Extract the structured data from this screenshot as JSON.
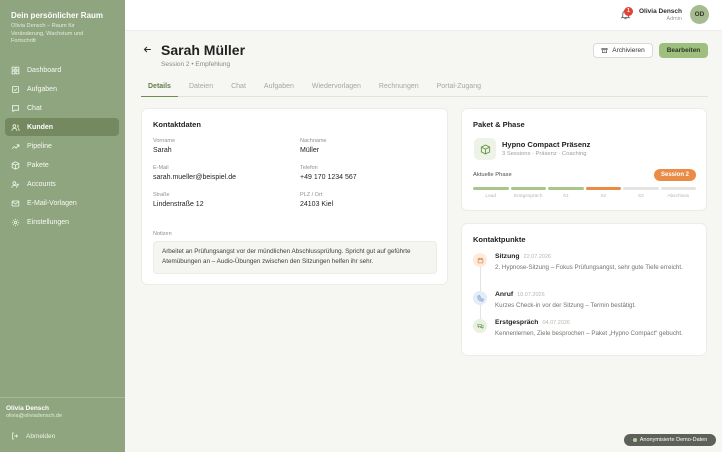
{
  "brand": {
    "title": "Dein persönlicher Raum",
    "subtitle": "Olivia Densch – Raum für Veränderung, Wachstum und Fortschritt"
  },
  "nav": [
    {
      "label": "Dashboard",
      "icon": "dashboard-icon"
    },
    {
      "label": "Aufgaben",
      "icon": "tasks-icon"
    },
    {
      "label": "Chat",
      "icon": "chat-icon"
    },
    {
      "label": "Kunden",
      "icon": "users-icon",
      "active": true
    },
    {
      "label": "Pipeline",
      "icon": "pipeline-icon"
    },
    {
      "label": "Pakete",
      "icon": "package-icon"
    },
    {
      "label": "Accounts",
      "icon": "accounts-icon"
    },
    {
      "label": "E-Mail-Vorlagen",
      "icon": "mail-icon"
    },
    {
      "label": "Einstellungen",
      "icon": "gear-icon"
    }
  ],
  "sidebar_user": {
    "name": "Olivia Densch",
    "email": "olivia@oliviadensch.de",
    "logout": "Abmelden"
  },
  "topbar": {
    "notifications": "1",
    "name": "Olivia Densch",
    "role": "Admin",
    "initials": "OD"
  },
  "header": {
    "title": "Sarah Müller",
    "subtitle": "Session 2 • Empfehlung",
    "archive_label": "Archivieren",
    "edit_label": "Bearbeiten"
  },
  "tabs": [
    "Details",
    "Dateien",
    "Chat",
    "Aufgaben",
    "Wiedervorlagen",
    "Rechnungen",
    "Portal-Zugang"
  ],
  "contact": {
    "heading": "Kontaktdaten",
    "fields": [
      {
        "label": "Vorname",
        "value": "Sarah"
      },
      {
        "label": "Nachname",
        "value": "Müller"
      },
      {
        "label": "E-Mail",
        "value": "sarah.mueller@beispiel.de"
      },
      {
        "label": "Telefon",
        "value": "+49 170 1234 567"
      },
      {
        "label": "Straße",
        "value": "Lindenstraße 12"
      },
      {
        "label": "PLZ / Ort",
        "value": "24103 Kiel"
      }
    ],
    "notes_label": "Notizen",
    "notes": "Arbeitet an Prüfungsangst vor der mündlichen Abschlussprüfung. Spricht gut auf geführte Atemübungen an – Audio-Übungen zwischen den Sitzungen helfen ihr sehr."
  },
  "package": {
    "heading": "Paket & Phase",
    "name": "Hypno Compact Präsenz",
    "meta": "3 Sessions · Präsenz · Coaching",
    "phase_label": "Aktuelle Phase",
    "phase_badge": "Session 2",
    "phases": [
      {
        "name": "Lead",
        "state": "done"
      },
      {
        "name": "Erstgespräch",
        "state": "done"
      },
      {
        "name": "S1",
        "state": "done"
      },
      {
        "name": "S2",
        "state": "current"
      },
      {
        "name": "S3",
        "state": "todo"
      },
      {
        "name": "Abschluss",
        "state": "todo"
      }
    ],
    "colors": {
      "done": "#a9c78a",
      "current": "#ea8c45",
      "todo": "#e4e5e1"
    }
  },
  "touchpoints": {
    "heading": "Kontaktpunkte",
    "items": [
      {
        "title": "Sitzung",
        "date": "22.07.2026",
        "text": "2. Hypnose-Sitzung – Fokus Prüfungsangst, sehr gute Tiefe erreicht.",
        "icon": "calendar-icon",
        "bg": "#fdebdd",
        "fg": "#e07f3a"
      },
      {
        "title": "Anruf",
        "date": "18.07.2026",
        "text": "Kurzes Check-in vor der Sitzung – Termin bestätigt.",
        "icon": "phone-icon",
        "bg": "#e3ecf8",
        "fg": "#5a85c4"
      },
      {
        "title": "Erstgespräch",
        "date": "04.07.2026",
        "text": "Kennenlernen, Ziele besprochen – Paket „Hypno Compact“ gebucht.",
        "icon": "conversation-icon",
        "bg": "#e8f1df",
        "fg": "#6e9a4d"
      }
    ]
  },
  "demo_badge": "Anonymisierte Demo-Daten"
}
